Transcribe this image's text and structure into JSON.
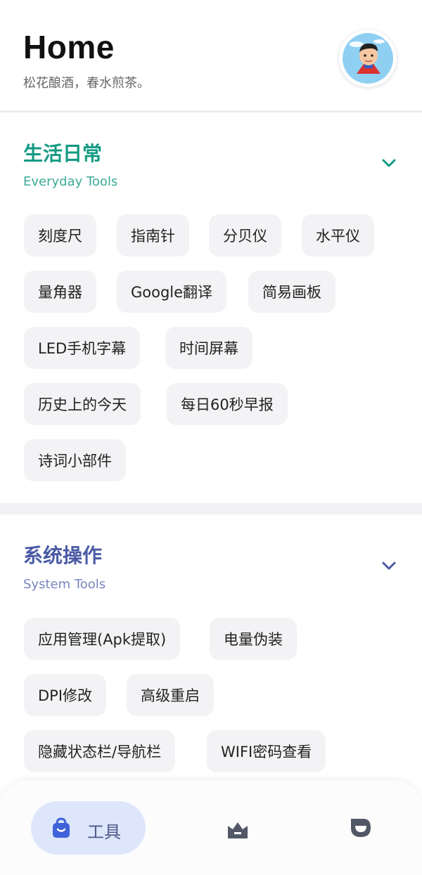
{
  "header": {
    "title": "Home",
    "subtitle": "松花酿酒，春水煎茶。"
  },
  "sections": [
    {
      "title": "生活日常",
      "subtitle": "Everyday Tools",
      "accent": "#139b82",
      "subtitle_color": "#3bab97",
      "tools": [
        "刻度尺",
        "指南针",
        "分贝仪",
        "水平仪",
        "量角器",
        "Google翻译",
        "简易画板",
        "LED手机字幕",
        "时间屏幕",
        "历史上的今天",
        "每日60秒早报",
        "诗词小部件"
      ]
    },
    {
      "title": "系统操作",
      "subtitle": "System Tools",
      "accent": "#4a5aa5",
      "subtitle_color": "#7a86c0",
      "tools": [
        "应用管理(Apk提取)",
        "电量伪装",
        "DPI修改",
        "高级重启",
        "隐藏状态栏/导航栏",
        "WIFI密码查看"
      ]
    }
  ],
  "nav": {
    "items": [
      {
        "label": "工具",
        "icon": "bag-icon",
        "active": true
      },
      {
        "label": "",
        "icon": "crown-icon",
        "active": false
      },
      {
        "label": "",
        "icon": "face-icon",
        "active": false
      }
    ],
    "active_bg": "#dde6fb",
    "active_color": "#3f63d8",
    "inactive_color": "#525866"
  }
}
